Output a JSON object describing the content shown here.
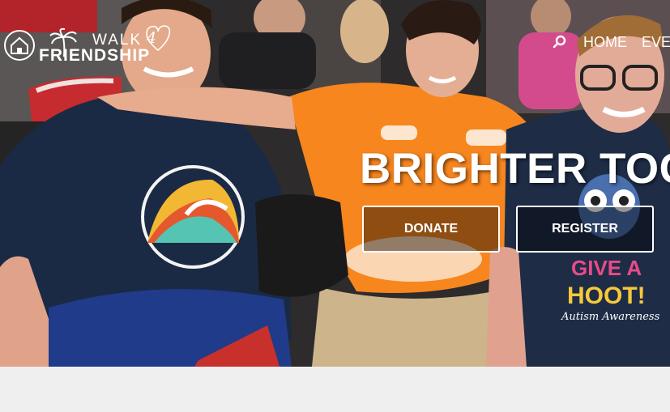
{
  "header": {
    "logo_alt": "Friendship House",
    "brand_walk": "WALK",
    "brand_number": "4",
    "brand_friendship": "FRIENDSHIP"
  },
  "nav": {
    "search_icon": "search-icon",
    "items": [
      {
        "label": "HOME"
      },
      {
        "label": "EVEN"
      }
    ]
  },
  "hero": {
    "headline": "BRIGHTER TOG",
    "buttons": {
      "donate": "DONATE",
      "register": "REGISTER"
    }
  },
  "colors": {
    "orange_shirt": "#f7861f",
    "navy_shirt": "#1b2a44",
    "button_border": "#ffffff"
  }
}
